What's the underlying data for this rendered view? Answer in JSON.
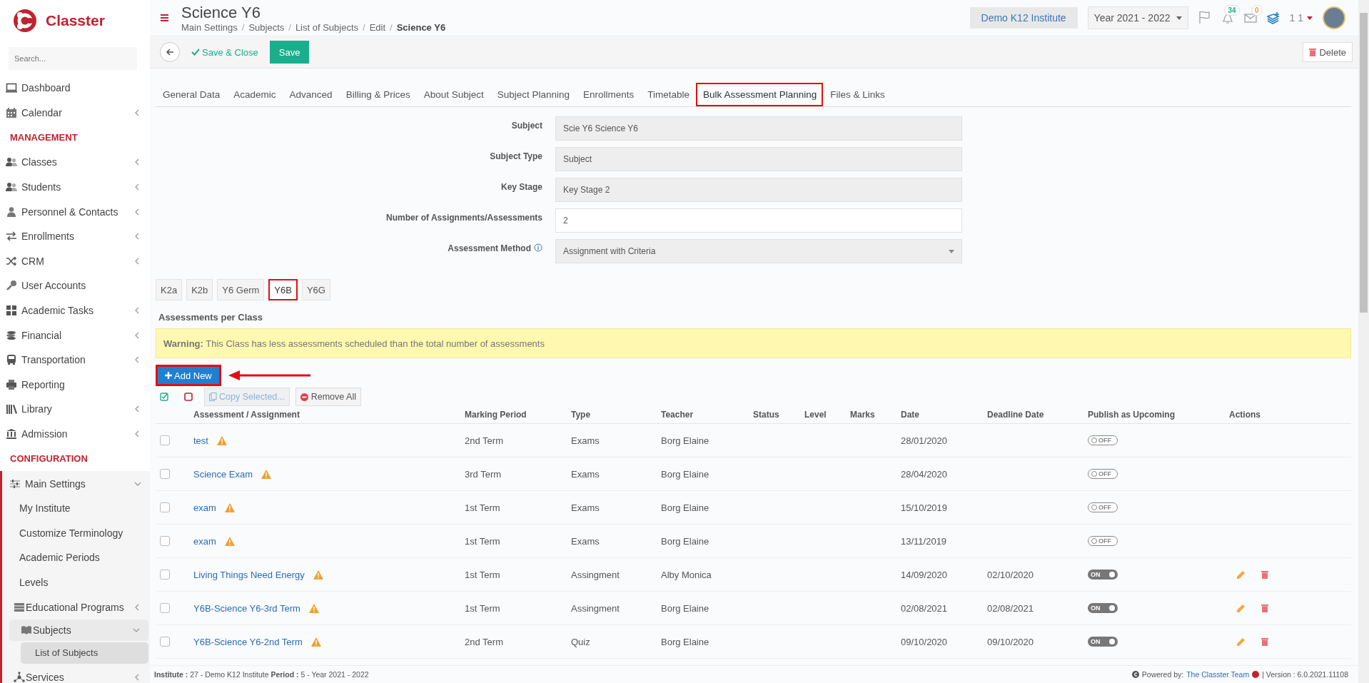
{
  "sidebar": {
    "logo": "Classter",
    "search": {
      "placeholder": "Search..."
    },
    "items": [
      {
        "kind": "item",
        "label": "Dashboard",
        "expandable": false,
        "selected": false
      },
      {
        "kind": "item",
        "label": "Calendar",
        "expandable": true,
        "expanded": false,
        "selected": false
      },
      {
        "kind": "heading",
        "label": "MANAGEMENT"
      },
      {
        "kind": "item",
        "label": "Classes",
        "expandable": true,
        "expanded": false,
        "selected": false
      },
      {
        "kind": "item",
        "label": "Students",
        "expandable": true,
        "expanded": false,
        "selected": false
      },
      {
        "kind": "item",
        "label": "Personnel & Contacts",
        "expandable": true,
        "expanded": false,
        "selected": false
      },
      {
        "kind": "item",
        "label": "Enrollments",
        "expandable": true,
        "expanded": false,
        "selected": false
      },
      {
        "kind": "item",
        "label": "CRM",
        "expandable": true,
        "expanded": false,
        "selected": false
      },
      {
        "kind": "item",
        "label": "User Accounts",
        "expandable": false,
        "selected": false
      },
      {
        "kind": "item",
        "label": "Academic Tasks",
        "expandable": true,
        "expanded": false,
        "selected": false
      },
      {
        "kind": "item",
        "label": "Financial",
        "expandable": true,
        "expanded": false,
        "selected": false
      },
      {
        "kind": "item",
        "label": "Transportation",
        "expandable": true,
        "expanded": false,
        "selected": false
      },
      {
        "kind": "item",
        "label": "Reporting",
        "expandable": false,
        "selected": false
      },
      {
        "kind": "item",
        "label": "Library",
        "expandable": true,
        "expanded": false,
        "selected": false
      },
      {
        "kind": "item",
        "label": "Admission",
        "expandable": true,
        "expanded": false,
        "selected": false
      },
      {
        "kind": "heading",
        "label": "CONFIGURATION"
      },
      {
        "kind": "item",
        "label": "Main Settings",
        "expandable": true,
        "expanded": true,
        "selected": false,
        "children": [
          {
            "kind": "item",
            "label": "My Institute",
            "expandable": false,
            "selected": false
          },
          {
            "kind": "item",
            "label": "Customize Terminology",
            "expandable": false,
            "selected": false
          },
          {
            "kind": "item",
            "label": "Academic Periods",
            "expandable": false,
            "selected": false
          },
          {
            "kind": "item",
            "label": "Levels",
            "expandable": false,
            "selected": false
          },
          {
            "kind": "item",
            "label": "Educational Programs",
            "expandable": true,
            "expanded": false,
            "selected": false
          },
          {
            "kind": "item",
            "label": "Subjects",
            "expandable": true,
            "expanded": true,
            "selected": false,
            "children": [
              {
                "kind": "item",
                "label": "List of Subjects",
                "expandable": false,
                "selected": true
              }
            ]
          },
          {
            "kind": "item",
            "label": "Services",
            "expandable": true,
            "expanded": false,
            "selected": false
          }
        ]
      }
    ]
  },
  "header": {
    "title": "Science Y6",
    "breadcrumb": [
      "Main Settings",
      "Subjects",
      "List of Subjects",
      "Edit",
      "Science Y6"
    ],
    "breadcrumb_separator": "/",
    "institute": "Demo K12 Institute",
    "year": "Year 2021 - 2022",
    "notifications": "34",
    "messages": "0",
    "user": "1 1"
  },
  "toolbar": {
    "save_close": "Save & Close",
    "save": "Save",
    "delete": "Delete"
  },
  "tabs": [
    {
      "label": "General Data",
      "selected": false
    },
    {
      "label": "Academic",
      "selected": false
    },
    {
      "label": "Advanced",
      "selected": false
    },
    {
      "label": "Billing & Prices",
      "selected": false
    },
    {
      "label": "About Subject",
      "selected": false
    },
    {
      "label": "Subject Planning",
      "selected": false
    },
    {
      "label": "Enrollments",
      "selected": false
    },
    {
      "label": "Timetable",
      "selected": false
    },
    {
      "label": "Bulk Assessment Planning",
      "selected": true
    },
    {
      "label": "Files & Links",
      "selected": false
    }
  ],
  "form": [
    {
      "label": "Subject",
      "value": "Scie Y6 Science Y6",
      "kind": "readonly",
      "info": false
    },
    {
      "label": "Subject Type",
      "value": "Subject",
      "kind": "readonly",
      "info": false
    },
    {
      "label": "Key Stage",
      "value": "Key Stage 2",
      "kind": "readonly",
      "info": false
    },
    {
      "label": "Number of Assignments/Assessments",
      "value": "2",
      "kind": "input",
      "info": false
    },
    {
      "label": "Assessment Method",
      "value": "Assignment with Criteria",
      "kind": "select",
      "info": true
    }
  ],
  "class_tabs": [
    {
      "label": "K2a",
      "selected": false
    },
    {
      "label": "K2b",
      "selected": false
    },
    {
      "label": "Y6 Germ",
      "selected": false
    },
    {
      "label": "Y6B",
      "selected": true
    },
    {
      "label": "Y6G",
      "selected": false
    }
  ],
  "section_title": "Assessments per Class",
  "warning": "**Warning:** This Class has less assessments scheduled than the total number of assessments",
  "add_new": "Add New",
  "copy_selected": "Copy Selected...",
  "remove_all": "Remove All",
  "table": {
    "columns": [
      "Assessment / Assignment",
      "Marking Period",
      "Type",
      "Teacher",
      "Status",
      "Level",
      "Marks",
      "Date",
      "Deadline Date",
      "Publish as Upcoming",
      "Actions"
    ],
    "rows": [
      {
        "checked": false,
        "title": "test",
        "warning": true,
        "marking_period": "2nd Term",
        "type": "Exams",
        "teacher": "Borg Elaine",
        "date": "28/01/2020",
        "deadline": "",
        "publish": false,
        "toggle_label": "OFF",
        "actions": false
      },
      {
        "checked": false,
        "title": "Science Exam",
        "warning": true,
        "marking_period": "3rd Term",
        "type": "Exams",
        "teacher": "Borg Elaine",
        "date": "28/04/2020",
        "deadline": "",
        "publish": false,
        "toggle_label": "OFF",
        "actions": false
      },
      {
        "checked": false,
        "title": "exam",
        "warning": true,
        "marking_period": "1st Term",
        "type": "Exams",
        "teacher": "Borg Elaine",
        "date": "15/10/2019",
        "deadline": "",
        "publish": false,
        "toggle_label": "OFF",
        "actions": false
      },
      {
        "checked": false,
        "title": "exam",
        "warning": true,
        "marking_period": "1st Term",
        "type": "Exams",
        "teacher": "Borg Elaine",
        "date": "13/11/2019",
        "deadline": "",
        "publish": false,
        "toggle_label": "OFF",
        "actions": false
      },
      {
        "checked": false,
        "title": "Living Things Need Energy",
        "warning": true,
        "marking_period": "1st Term",
        "type": "Assingment",
        "teacher": "Alby Monica",
        "date": "14/09/2020",
        "deadline": "02/10/2020",
        "publish": true,
        "toggle_label": "ON",
        "actions": true
      },
      {
        "checked": false,
        "title": "Y6B-Science Y6-3rd Term",
        "warning": true,
        "marking_period": "1st Term",
        "type": "Assingment",
        "teacher": "Borg Elaine",
        "date": "02/08/2021",
        "deadline": "02/08/2021",
        "publish": true,
        "toggle_label": "ON",
        "actions": true
      },
      {
        "checked": false,
        "title": "Y6B-Science Y6-2nd Term",
        "warning": true,
        "marking_period": "2nd Term",
        "type": "Quiz",
        "teacher": "Borg Elaine",
        "date": "09/10/2020",
        "deadline": "09/10/2020",
        "publish": true,
        "toggle_label": "ON",
        "actions": true
      }
    ]
  },
  "footer": {
    "info": "**Institute :** 27 - Demo K12 Institute **Period :** 5 - Year 2021 - 2022",
    "powered": "Powered by:",
    "team": "The Classter Team",
    "version": "| Version : 6.0.2021.11108"
  }
}
